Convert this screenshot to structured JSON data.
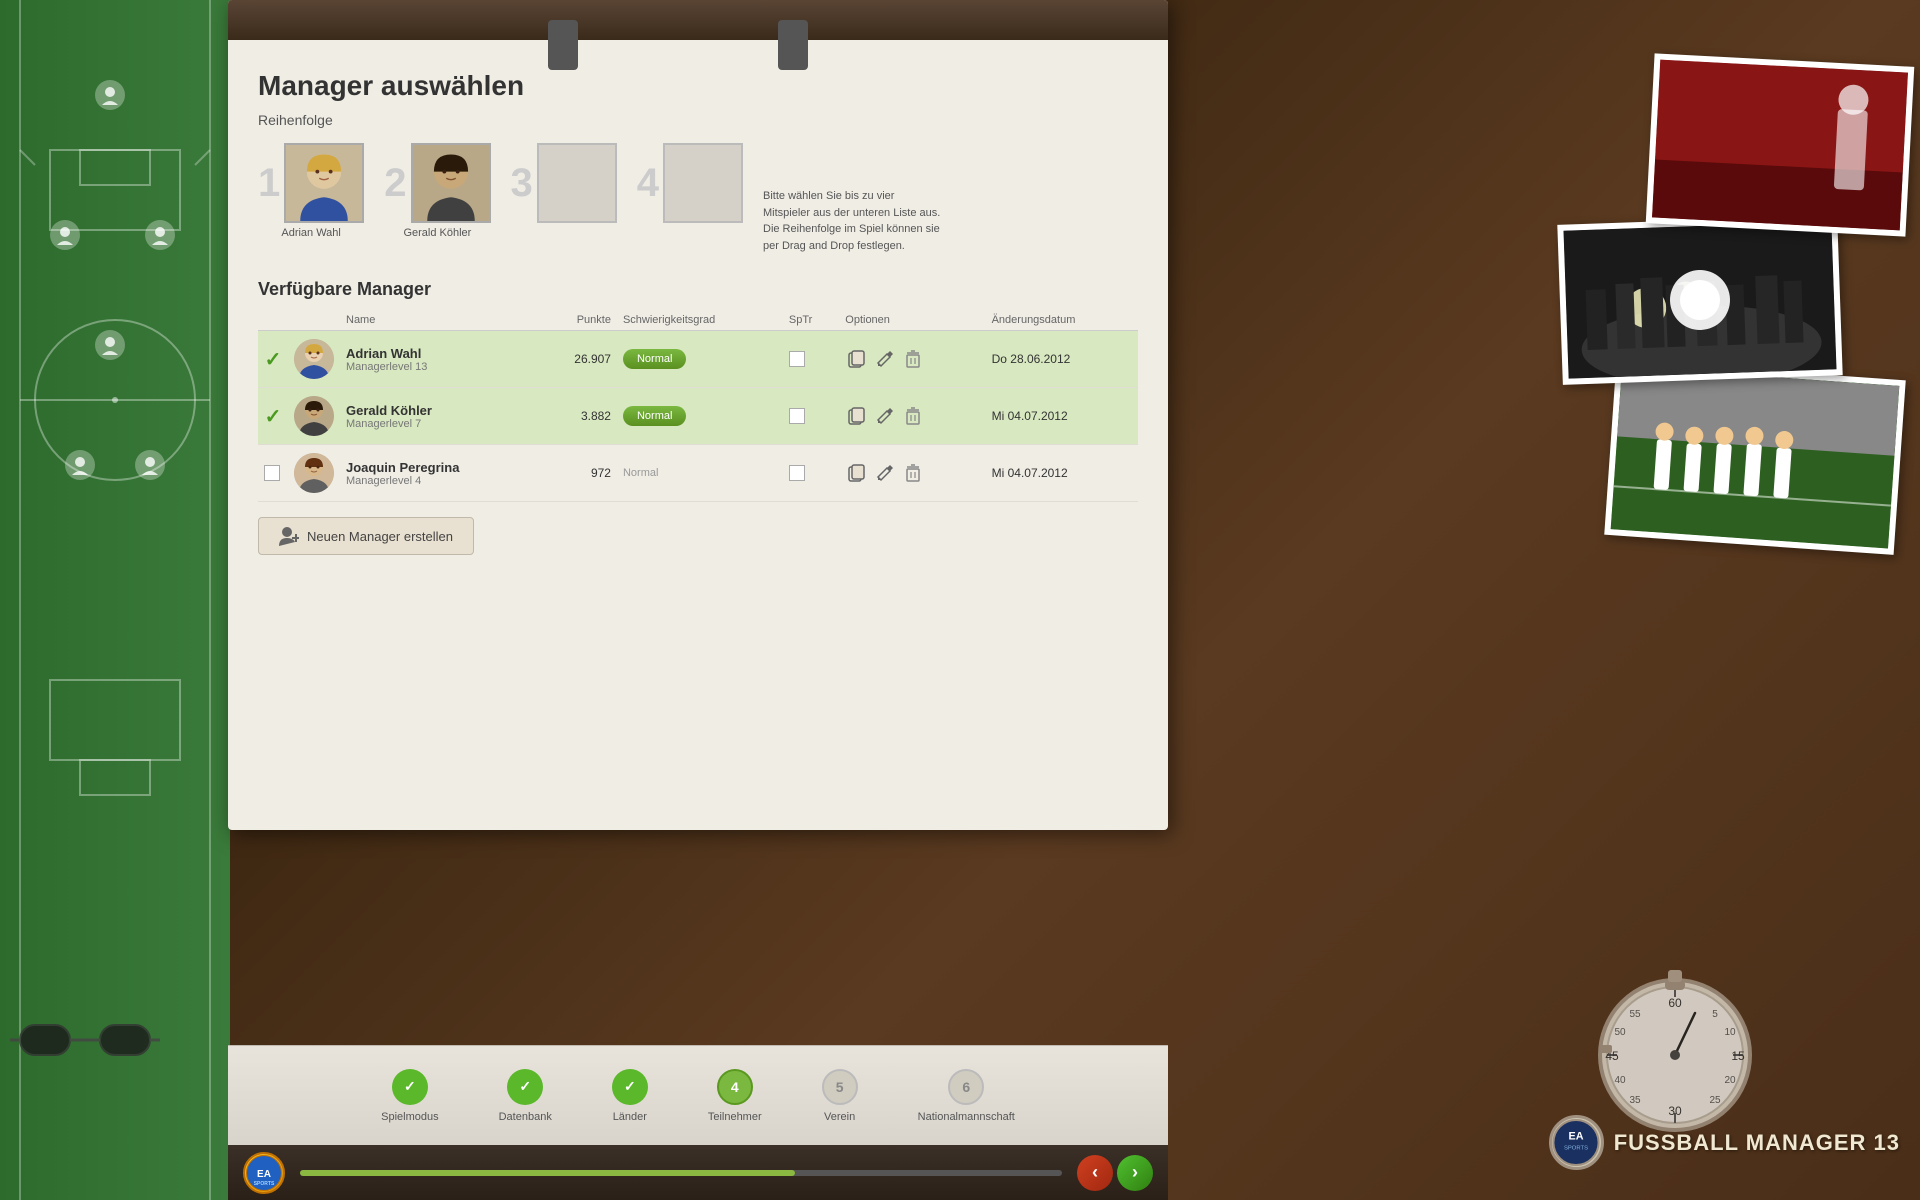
{
  "title": "Manager auswählen",
  "section_order_label": "Reihenfolge",
  "selection_info": "Bitte wählen Sie bis zu vier Mitspieler aus der unteren Liste aus. Die Reihenfolge im Spiel können sie per Drag and Drop festlegen.",
  "slots": [
    {
      "number": "1",
      "name": "Adrian Wahl",
      "filled": true
    },
    {
      "number": "2",
      "name": "Gerald Köhler",
      "filled": true
    },
    {
      "number": "3",
      "name": "",
      "filled": false
    },
    {
      "number": "4",
      "name": "",
      "filled": false
    }
  ],
  "table_section_title": "Verfügbare Manager",
  "table_headers": {
    "name": "Name",
    "points": "Punkte",
    "difficulty": "Schwierigkeitsgrad",
    "sptr": "SpTr",
    "options": "Optionen",
    "date": "Änderungsdatum"
  },
  "managers": [
    {
      "selected": true,
      "name": "Adrian Wahl",
      "level": "Managerlevel 13",
      "points": "26.907",
      "difficulty": "Normal",
      "difficulty_active": true,
      "date": "Do 28.06.2012"
    },
    {
      "selected": true,
      "name": "Gerald Köhler",
      "level": "Managerlevel 7",
      "points": "3.882",
      "difficulty": "Normal",
      "difficulty_active": true,
      "date": "Mi 04.07.2012"
    },
    {
      "selected": false,
      "name": "Joaquin Peregrina",
      "level": "Managerlevel 4",
      "points": "972",
      "difficulty": "Normal",
      "difficulty_active": false,
      "date": "Mi 04.07.2012"
    }
  ],
  "create_manager_btn": "Neuen Manager erstellen",
  "nav_steps": [
    {
      "number": "✓",
      "label": "Spielmodus",
      "state": "done"
    },
    {
      "number": "✓",
      "label": "Datenbank",
      "state": "done"
    },
    {
      "number": "✓",
      "label": "Länder",
      "state": "done"
    },
    {
      "number": "4",
      "label": "Teilnehmer",
      "state": "active"
    },
    {
      "number": "5",
      "label": "Verein",
      "state": "inactive"
    },
    {
      "number": "6",
      "label": "Nationalmannschaft",
      "state": "inactive"
    }
  ],
  "nav_back": "‹",
  "nav_forward": "›",
  "game_title": "FUSSBALL MANAGER 13",
  "ea_sports_text": "EA SPORTS"
}
